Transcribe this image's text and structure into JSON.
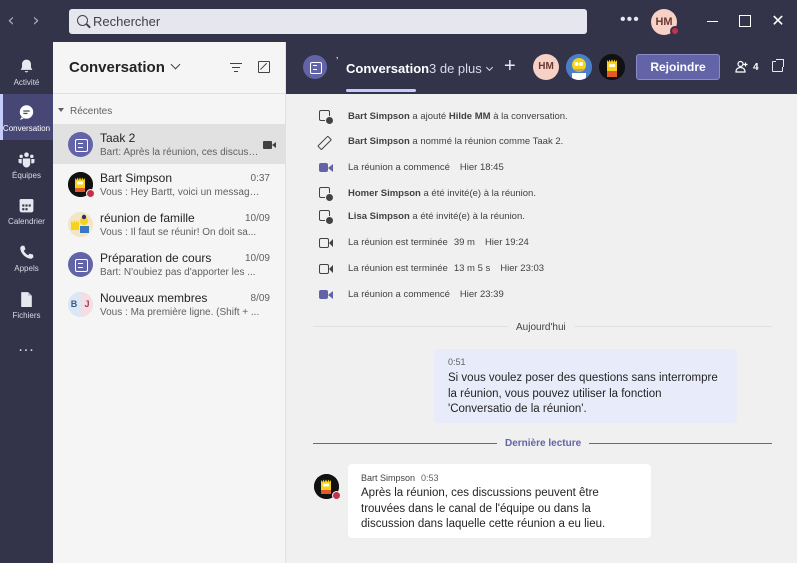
{
  "titlebar": {
    "search_placeholder": "Rechercher",
    "user_initials": "HM"
  },
  "appbar": {
    "items": [
      {
        "label": "Activité",
        "icon": "bell-icon"
      },
      {
        "label": "Conversation",
        "icon": "chat-icon",
        "active": true
      },
      {
        "label": "Équipes",
        "icon": "teams-icon"
      },
      {
        "label": "Calendrier",
        "icon": "calendar-icon"
      },
      {
        "label": "Appels",
        "icon": "phone-icon"
      },
      {
        "label": "Fichiers",
        "icon": "file-icon"
      }
    ],
    "more": "..."
  },
  "list": {
    "title": "Conversation",
    "section": "Récentes",
    "chats": [
      {
        "name": "Taak 2",
        "preview": "Bart: Après la réunion, ces discussions peuvent être trouvées",
        "time": "",
        "type": "meeting",
        "selected": true
      },
      {
        "name": "Bart Simpson",
        "preview": "Vous : Hey Bartt, voici un message...",
        "time": "0:37",
        "type": "bart"
      },
      {
        "name": "réunion de famille",
        "preview": "Vous : Il faut se réunir! On doit sa...",
        "time": "10/09",
        "type": "group"
      },
      {
        "name": "Préparation de cours",
        "preview": "Bart: N'oubiez pas d'apporter les ...",
        "time": "10/09",
        "type": "meeting"
      },
      {
        "name": "Nouveaux membres",
        "preview": "Vous : Ma première ligne. (Shift + ...",
        "time": "8/09",
        "type": "bj"
      }
    ]
  },
  "header": {
    "tab_active": "Conversation",
    "more_tabs": "3 de plus",
    "add": "+",
    "avatar_initials": "HM",
    "join_label": "Rejoindre",
    "participants_count": "4"
  },
  "events": [
    {
      "icon": "add-person-icon",
      "actor": "Bart Simpson",
      "text": " a ajouté ",
      "target": "Hilde MM",
      "suffix": " à la conversation.",
      "time": ""
    },
    {
      "icon": "pencil-icon",
      "actor": "Bart Simpson",
      "text": " a nommé la réunion comme Taak 2.",
      "target": "",
      "suffix": "",
      "time": ""
    },
    {
      "icon": "video-started-icon",
      "actor": "",
      "text": "La réunion a commencé",
      "target": "",
      "suffix": "",
      "time": "Hier 18:45"
    },
    {
      "icon": "add-person-icon",
      "actor": "Homer Simpson",
      "text": " a été invité(e) à la réunion.",
      "target": "",
      "suffix": "",
      "time": ""
    },
    {
      "icon": "add-person-icon",
      "actor": "Lisa Simpson",
      "text": " a été invité(e) à la réunion.",
      "target": "",
      "suffix": "",
      "time": ""
    },
    {
      "icon": "video-ended-icon",
      "actor": "",
      "text": "La réunion est terminée",
      "target": "",
      "suffix": "",
      "duration": "39 m",
      "time": "Hier 19:24"
    },
    {
      "icon": "video-ended-icon",
      "actor": "",
      "text": "La réunion est terminée",
      "target": "",
      "suffix": "",
      "duration": "13 m 5 s",
      "time": "Hier 23:03"
    },
    {
      "icon": "video-started-icon",
      "actor": "",
      "text": "La réunion a commencé",
      "target": "",
      "suffix": "",
      "time": "Hier 23:39"
    }
  ],
  "messages": {
    "today_label": "Aujourd'hui",
    "last_read_label": "Dernière lecture",
    "mine": {
      "time": "0:51",
      "text": "Si vous voulez poser des questions sans interrompre la réunion, vous pouvez utiliser la fonction 'Conversatio de la réunion'."
    },
    "theirs": {
      "author": "Bart Simpson",
      "time": "0:53",
      "text": "Après la réunion, ces discussions peuvent être trouvées dans le canal de l'équipe ou dans la discussion dans laquelle cette réunion a eu lieu."
    }
  },
  "colors": {
    "chrome": "#33344a",
    "accent": "#6264a7",
    "my_bubble": "#e8ebfa",
    "status_busy": "#c4314b"
  }
}
